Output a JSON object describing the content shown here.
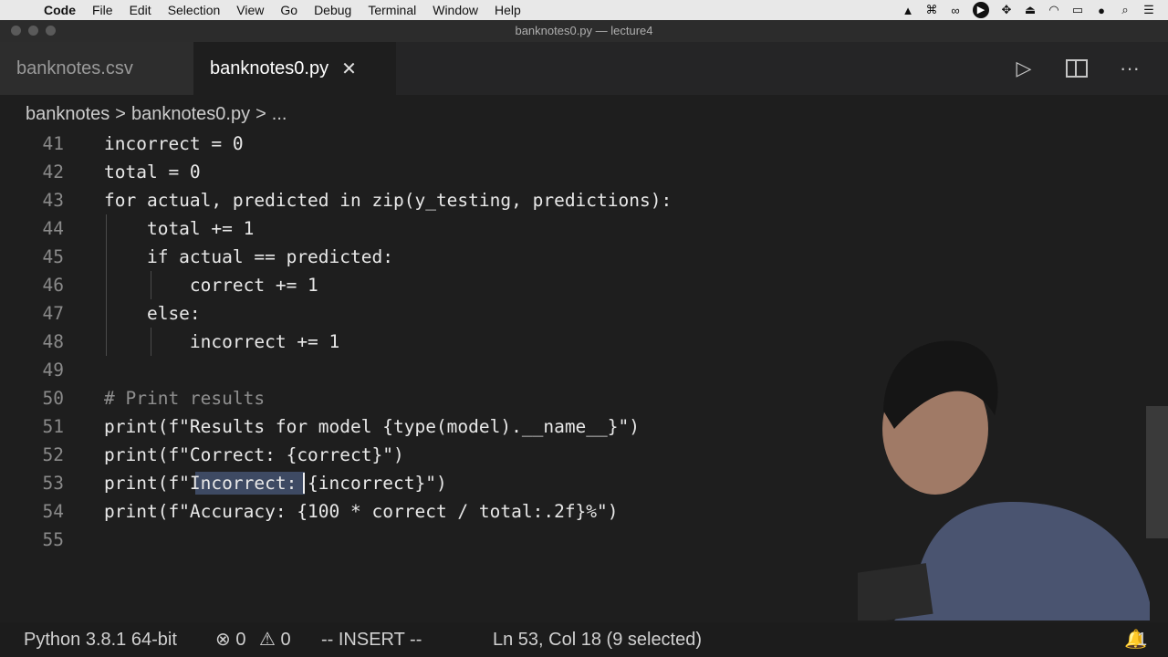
{
  "menubar": {
    "apple_icon": "apple-logo",
    "items": [
      "Code",
      "File",
      "Edit",
      "Selection",
      "View",
      "Go",
      "Debug",
      "Terminal",
      "Window",
      "Help"
    ],
    "status_icons": [
      "docker-icon",
      "command-icon",
      "glasses-icon",
      "play-circle-icon",
      "move-icon",
      "eject-icon",
      "wifi-icon",
      "battery-icon",
      "user-icon",
      "search-icon",
      "list-icon"
    ]
  },
  "window": {
    "title": "banknotes0.py — lecture4"
  },
  "tabs": [
    {
      "label": "banknotes.csv",
      "active": false
    },
    {
      "label": "banknotes0.py",
      "active": true,
      "close": "✕"
    }
  ],
  "breadcrumb": {
    "folder": "banknotes",
    "sep1": ">",
    "file": "banknotes0.py",
    "sep2": ">",
    "more": "..."
  },
  "code": {
    "lines": [
      {
        "number": "41",
        "text": "incorrect = 0"
      },
      {
        "number": "42",
        "text": "total = 0"
      },
      {
        "number": "43",
        "text": "for actual, predicted in zip(y_testing, predictions):"
      },
      {
        "number": "44",
        "text": "    total += 1"
      },
      {
        "number": "45",
        "text": "    if actual == predicted:"
      },
      {
        "number": "46",
        "text": "        correct += 1"
      },
      {
        "number": "47",
        "text": "    else:"
      },
      {
        "number": "48",
        "text": "        incorrect += 1"
      },
      {
        "number": "49",
        "text": ""
      },
      {
        "number": "50",
        "text": "# Print results"
      },
      {
        "number": "51",
        "text": "print(f\"Results for model {type(model).__name__}\")"
      },
      {
        "number": "52",
        "text": "print(f\"Correct: {correct}\")"
      },
      {
        "number": "53",
        "text": "print(f\"Incorrect: {incorrect}\")"
      },
      {
        "number": "54",
        "text": "print(f\"Accuracy: {100 * correct / total:.2f}%\")"
      },
      {
        "number": "55",
        "text": ""
      }
    ],
    "selected_text": "Incorrect"
  },
  "statusbar": {
    "interpreter": "Python 3.8.1 64-bit",
    "errors": "⊗ 0",
    "warnings": "⚠ 0",
    "mode": "-- INSERT --",
    "position": "Ln 53, Col 18 (9 selected)",
    "notifications": "1"
  }
}
